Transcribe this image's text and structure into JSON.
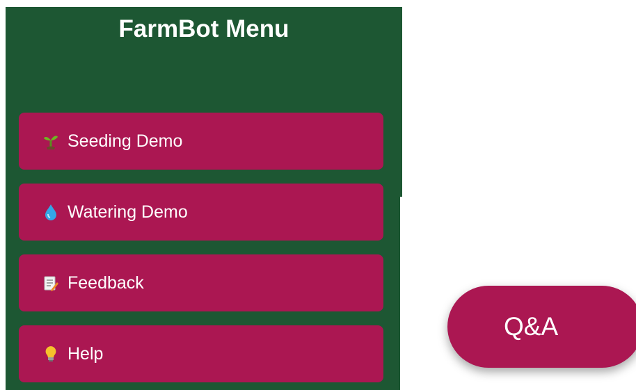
{
  "menu": {
    "title": "FarmBot Menu",
    "items": [
      {
        "label": "Seeding Demo",
        "icon": "seedling-icon"
      },
      {
        "label": "Watering Demo",
        "icon": "water-drop-icon"
      },
      {
        "label": "Feedback",
        "icon": "memo-icon"
      },
      {
        "label": "Help",
        "icon": "lightbulb-icon"
      }
    ]
  },
  "qa": {
    "label": "Q&A"
  },
  "colors": {
    "panel": "#1d5733",
    "button": "#ab1752",
    "text": "#ffffff"
  }
}
